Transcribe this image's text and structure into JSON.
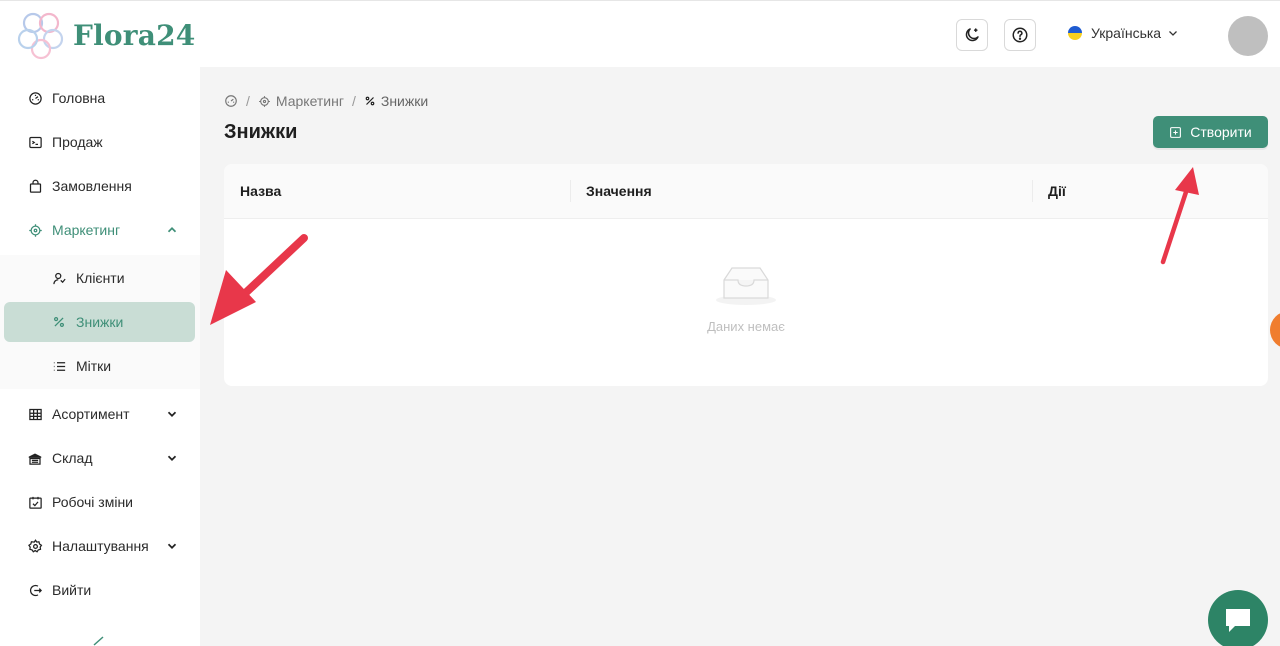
{
  "header": {
    "logo_text": "Flora24",
    "language": "Українська",
    "colors": {
      "brand": "#3f8f78",
      "flag_blue": "#1f5bd1",
      "flag_yellow": "#f7cf1e"
    }
  },
  "sidebar": {
    "items": [
      {
        "label": "Головна",
        "icon": "dashboard-icon"
      },
      {
        "label": "Продаж",
        "icon": "terminal-icon"
      },
      {
        "label": "Замовлення",
        "icon": "shopping-bag-icon"
      },
      {
        "label": "Маркетинг",
        "icon": "target-icon",
        "expanded": true
      },
      {
        "label": "Клієнти",
        "icon": "users-icon"
      },
      {
        "label": "Знижки",
        "icon": "percent-icon",
        "active": true
      },
      {
        "label": "Мітки",
        "icon": "list-icon"
      },
      {
        "label": "Асортимент",
        "icon": "table-icon"
      },
      {
        "label": "Склад",
        "icon": "warehouse-icon"
      },
      {
        "label": "Робочі зміни",
        "icon": "calendar-check-icon"
      },
      {
        "label": "Налаштування",
        "icon": "gear-icon"
      },
      {
        "label": "Вийти",
        "icon": "logout-icon"
      }
    ]
  },
  "breadcrumb": {
    "items": [
      {
        "label": "",
        "icon": "dashboard-icon"
      },
      {
        "label": "Маркетинг",
        "icon": "target-icon"
      },
      {
        "label": "Знижки",
        "icon": "percent-icon"
      }
    ]
  },
  "page": {
    "title": "Знижки",
    "create_label": "Створити"
  },
  "table": {
    "columns": [
      "Назва",
      "Значення",
      "Дії"
    ],
    "empty_text": "Даних немає"
  },
  "colors": {
    "accent": "#3f8f78",
    "active_bg": "#c9ddd5",
    "arrow": "#e8374a",
    "chat": "#2d8466",
    "orange": "#f07d2e"
  }
}
